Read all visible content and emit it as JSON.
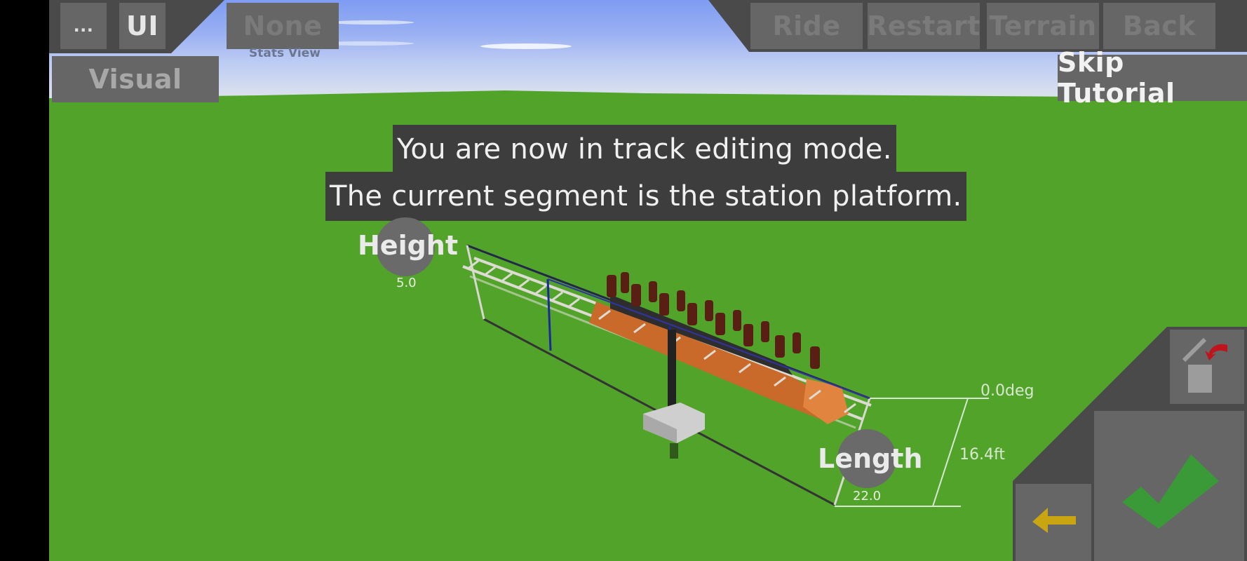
{
  "toolbar_left": {
    "more_label": "...",
    "ui_label": "UI",
    "visual_label": "Visual",
    "stats_value": "None",
    "stats_caption": "Stats View"
  },
  "toolbar_right": {
    "ride_label": "Ride",
    "restart_label": "Restart",
    "terrain_label": "Terrain",
    "back_label": "Back",
    "skip_tutorial_label": "Skip Tutorial"
  },
  "tutorial": {
    "line1": "You are now in track editing mode.",
    "line2": "The current segment is the station platform."
  },
  "handles": {
    "height": {
      "label": "Height",
      "value": "5.0"
    },
    "length": {
      "label": "Length",
      "value": "22.0"
    }
  },
  "measurements": {
    "angle": "0.0deg",
    "height_ft": "16.4ft"
  },
  "controls": {
    "delete_icon": "trash-undo-icon",
    "back_icon": "arrow-left-icon",
    "confirm_icon": "checkmark-icon"
  },
  "colors": {
    "ground": "#52a32a",
    "panel": "#4a4a4a",
    "button": "#666666",
    "confirm_green": "#3a9a38",
    "arrow_yellow": "#c9a512",
    "undo_red": "#c0141c",
    "car_orange": "#d9772e"
  }
}
